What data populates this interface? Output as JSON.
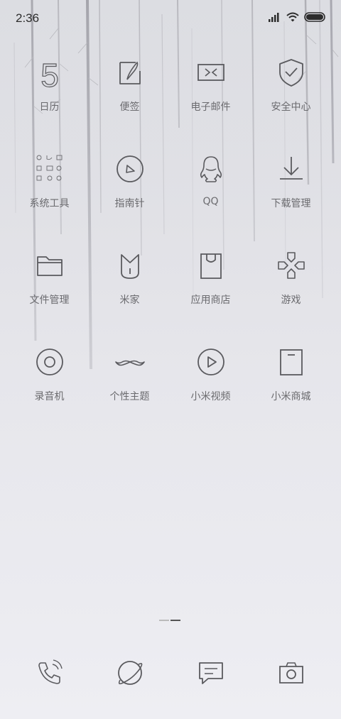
{
  "status_bar": {
    "time": "2:36"
  },
  "apps": [
    {
      "label": "日历",
      "icon": "calendar-icon",
      "calendar_day": "5"
    },
    {
      "label": "便签",
      "icon": "notes-icon"
    },
    {
      "label": "电子邮件",
      "icon": "email-icon"
    },
    {
      "label": "安全中心",
      "icon": "security-shield-icon"
    },
    {
      "label": "系统工具",
      "icon": "system-tools-folder-icon"
    },
    {
      "label": "指南针",
      "icon": "compass-icon"
    },
    {
      "label": "QQ",
      "icon": "qq-penguin-icon"
    },
    {
      "label": "下载管理",
      "icon": "download-icon"
    },
    {
      "label": "文件管理",
      "icon": "folder-icon"
    },
    {
      "label": "米家",
      "icon": "mijia-icon"
    },
    {
      "label": "应用商店",
      "icon": "app-store-bag-icon"
    },
    {
      "label": "游戏",
      "icon": "gamepad-icon"
    },
    {
      "label": "录音机",
      "icon": "recorder-icon"
    },
    {
      "label": "个性主题",
      "icon": "mustache-theme-icon"
    },
    {
      "label": "小米视频",
      "icon": "video-play-icon"
    },
    {
      "label": "小米商城",
      "icon": "mi-store-icon"
    }
  ],
  "dock": [
    {
      "icon": "phone-icon"
    },
    {
      "icon": "browser-planet-icon"
    },
    {
      "icon": "messages-icon"
    },
    {
      "icon": "camera-icon"
    }
  ],
  "page_indicator": {
    "pages": 2,
    "current": 2
  }
}
